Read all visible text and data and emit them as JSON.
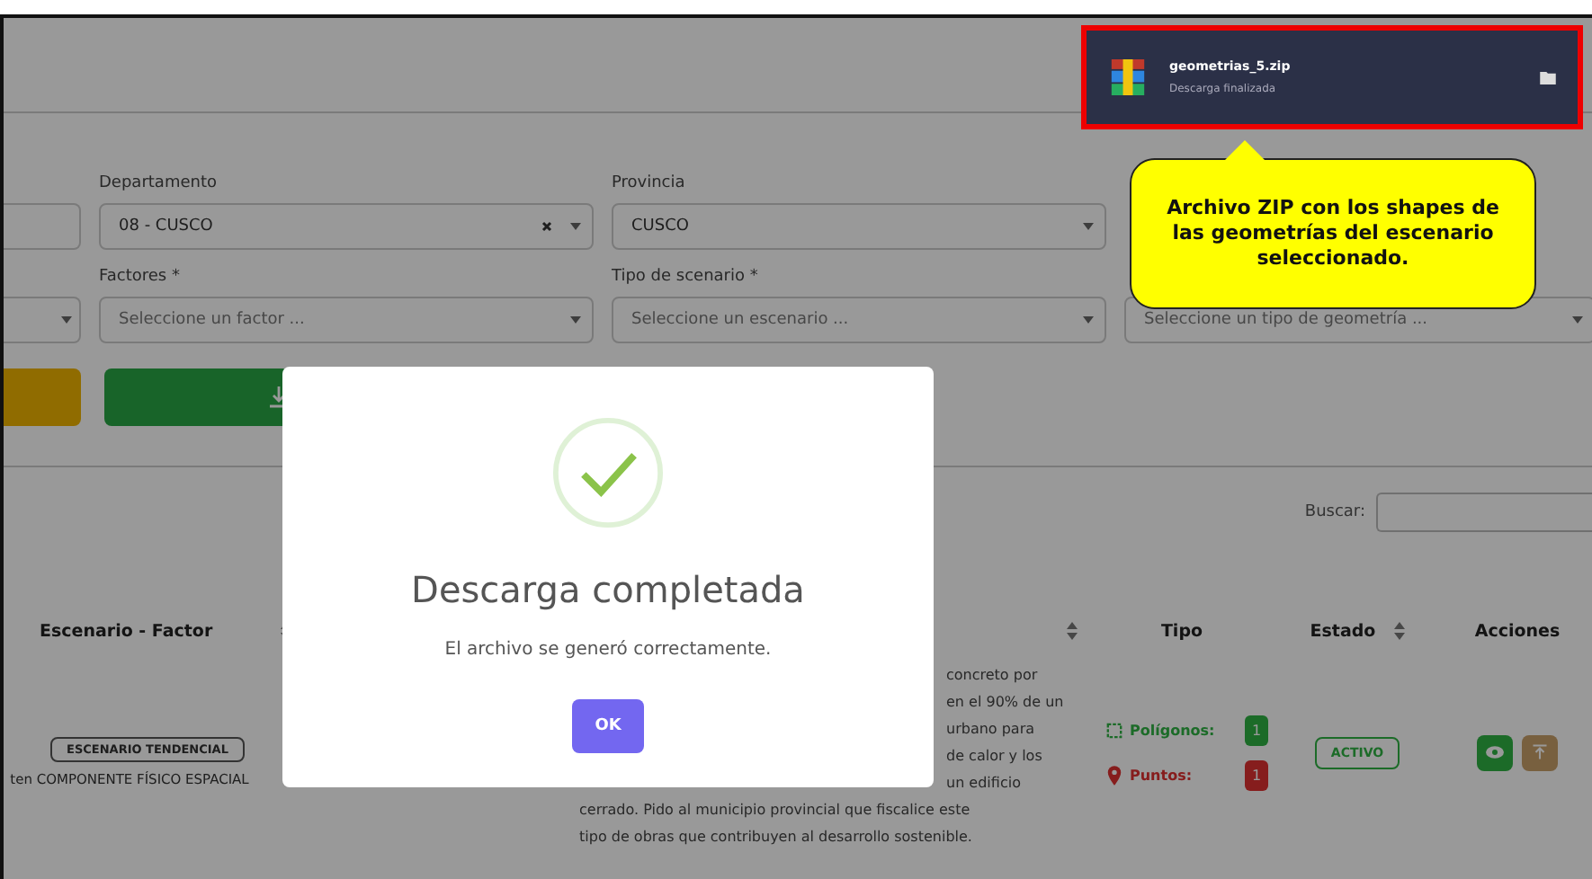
{
  "download": {
    "file_name": "geometrias_5.zip",
    "status": "Descarga finalizada"
  },
  "callout": {
    "text": "Archivo ZIP con los shapes de las geometrías del escenario seleccionado."
  },
  "filter_rows": [
    {
      "fields": [
        {
          "value": "08 - CUSCO",
          "label": "Departamento",
          "clearable": true
        },
        {
          "value": "CUSCO",
          "label": "Provincia",
          "clearable": false
        }
      ]
    },
    {
      "fields": [
        {
          "placeholder": "Seleccione un factor ...",
          "label": "Factores *",
          "clearable": false
        },
        {
          "placeholder": "Seleccione un escenario ...",
          "label": "Tipo de scenario *",
          "clearable": false
        },
        {
          "placeholder": "Seleccione un tipo de geometría ...",
          "clearable": false
        }
      ]
    }
  ],
  "search": {
    "label": "Buscar:"
  },
  "columns": [
    {
      "label": "Escenario - Factor",
      "sortable": true
    },
    {
      "sortable": true
    },
    {
      "label": "Tipo",
      "sortable": false
    },
    {
      "label": "Estado",
      "sortable": true
    },
    {
      "label": "Acciones",
      "sortable": false
    }
  ],
  "rows": [
    {
      "scenario": "ESCENARIO TENDENCIAL",
      "factor": "ten COMPONENTE FÍSICO ESPACIAL",
      "description_partial": [
        "concreto por",
        "en el 90% de un",
        "urbano para",
        "de calor y los",
        "un edificio"
      ],
      "description_full": [
        "cerrado. Pido al municipio provincial que fiscalice este",
        "tipo de obras que contribuyen al desarrollo sostenible."
      ],
      "types": [
        {
          "kind": "polygon",
          "label": "Polígonos:",
          "count": "1"
        },
        {
          "kind": "point",
          "label": "Puntos:",
          "count": "1"
        }
      ],
      "status": "ACTIVO",
      "actions": [
        {
          "kind": "view"
        },
        {
          "kind": "upload"
        }
      ]
    }
  ],
  "modal": {
    "title": "Descarga completada",
    "message": "El archivo se generó correctamente.",
    "button": "OK"
  }
}
